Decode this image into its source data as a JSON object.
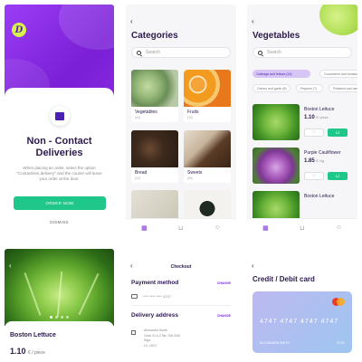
{
  "screen1": {
    "logo_letter": "D",
    "title_line1": "Non - Contact",
    "title_line2": "Deliveries",
    "description": "When placing an order, select the option \"Contactless delivery\" and the courier will leave your order at the door.",
    "order_button": "ORDER NOW",
    "dismiss": "DISMISS"
  },
  "screen2": {
    "back": "‹",
    "title": "Categories",
    "search_placeholder": "Search",
    "categories": [
      {
        "name": "Vegetables",
        "count": "(43)"
      },
      {
        "name": "Fruits",
        "count": "(32)"
      },
      {
        "name": "Bread",
        "count": "(22)"
      },
      {
        "name": "Sweets",
        "count": "(56)"
      }
    ]
  },
  "screen3": {
    "back": "‹",
    "title": "Vegetables",
    "search_placeholder": "Search",
    "chips": [
      "Cabbage and lettuce (14)",
      "Cucumbers and tomatoes (10)",
      "Onions and garlic (8)",
      "Peppers (7)",
      "Potatoes and carrots (4)"
    ],
    "products": [
      {
        "name": "Boston Lettuce",
        "price": "1.10",
        "unit": "€ / piece"
      },
      {
        "name": "Purple Cauliflower",
        "price": "1.85",
        "unit": "€ / kg"
      },
      {
        "name": "Boston Lettuce",
        "price": "",
        "unit": ""
      }
    ]
  },
  "screen4": {
    "back": "‹",
    "name": "Boston Lettuce",
    "price": "1.10",
    "unit": "€ / piece"
  },
  "screen5": {
    "back": "‹",
    "title": "Checkout",
    "payment_title": "Payment method",
    "payment_change": "CHANGE",
    "card_masked": "**** **** **** 4747",
    "delivery_title": "Delivery address",
    "delivery_change": "CHANGE",
    "address_line1": "Alexandra Smith",
    "address_line2": "Cesu 31 k-2 5st, SIA Chili",
    "address_line3": "Riga",
    "address_line4": "LV–1012"
  },
  "screen6": {
    "back": "‹",
    "title": "Credit / Debit card",
    "card_number": "4747  4747  4747  4747",
    "card_holder": "ALEXANDRA SMITH",
    "card_expiry": "07/21"
  }
}
